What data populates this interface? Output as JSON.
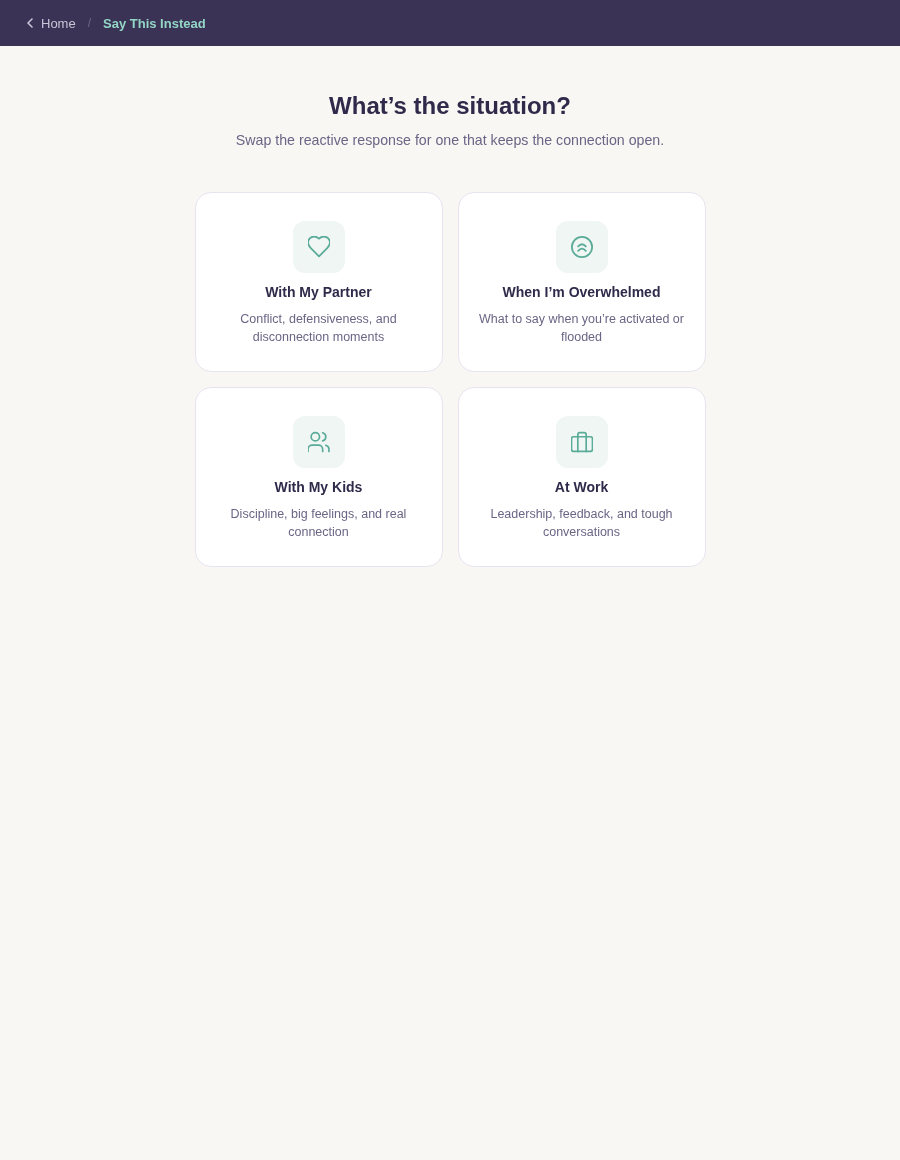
{
  "nav": {
    "separator": "/",
    "breadcrumb": [
      {
        "label": "Home",
        "current": false
      },
      {
        "label": "Say This Instead",
        "current": true
      }
    ]
  },
  "header": {
    "title": "What’s the situation?",
    "subtitle": "Swap the reactive response for one that keeps the connection open."
  },
  "cards": [
    {
      "kind": "partner",
      "title": "With My Partner",
      "description": "Conflict, defensiveness, and disconnection moments"
    },
    {
      "kind": "overwhelmed",
      "title": "When I’m Overwhelmed",
      "description": "What to say when you’re activated or flooded"
    },
    {
      "kind": "kids",
      "title": "With My Kids",
      "description": "Discipline, big feelings, and real connection"
    },
    {
      "kind": "work",
      "title": "At Work",
      "description": "Leadership, feedback, and tough conversations"
    }
  ]
}
